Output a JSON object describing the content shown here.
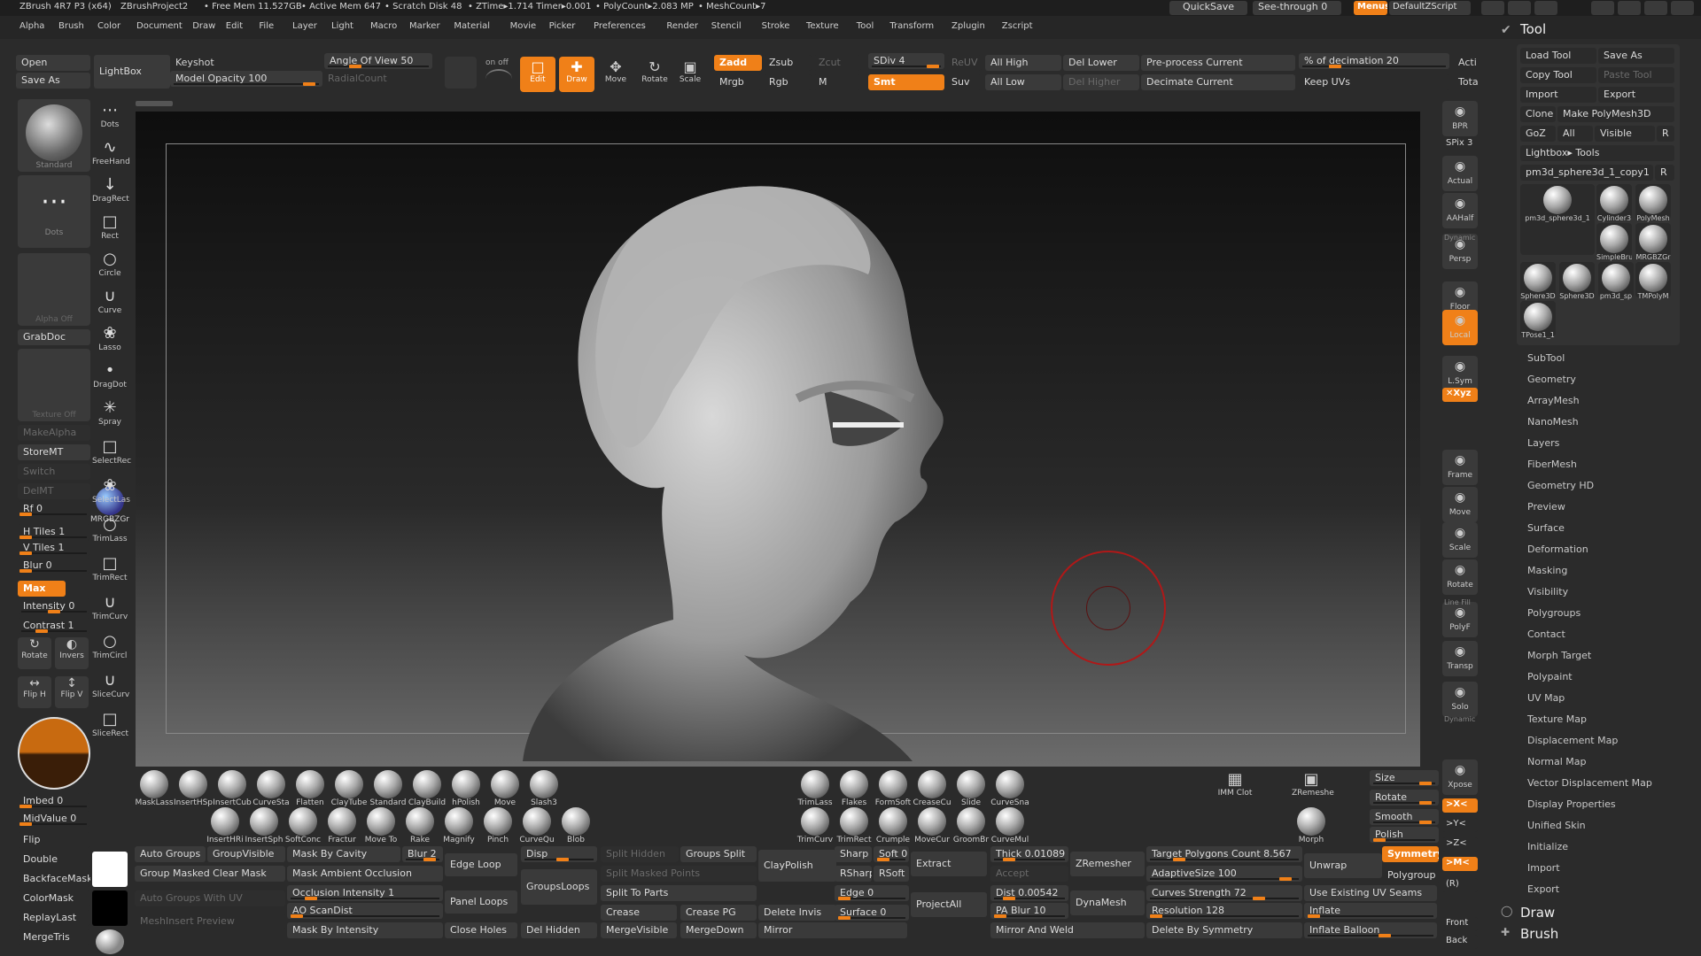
{
  "titlebar": {
    "app": "ZBrush 4R7 P3 (x64)",
    "project": "ZBrushProject2",
    "free_mem": "• Free Mem 11.527GB",
    "active_mem": "• Active Mem 647",
    "scratch": "• Scratch Disk 48",
    "ztime": "• ZTime▸1.714 Timer▸0.001",
    "polycount": "• PolyCount▸2.083 MP",
    "meshcount": "• MeshCount▸7",
    "quicksave": "QuickSave",
    "seethrough": "See-through  0",
    "menus": "Menus",
    "defaultzscript": "DefaultZScript"
  },
  "menu": [
    "Alpha",
    "Brush",
    "Color",
    "Document",
    "Draw",
    "Edit",
    "File",
    "Layer",
    "Light",
    "Macro",
    "Marker",
    "Material",
    "Movie",
    "Picker",
    "Preferences",
    "Render",
    "Stencil",
    "Stroke",
    "Texture",
    "Tool",
    "Transform",
    "Zplugin",
    "Zscript"
  ],
  "toolbar": {
    "open": "Open",
    "save_as": "Save As",
    "lightbox": "LightBox",
    "keyshot": "Keyshot",
    "model_opacity": "Model Opacity 100",
    "angle_of_view": "Angle Of View 50",
    "radialcount": "RadialCount",
    "edit": "Edit",
    "draw": "Draw",
    "move": "Move",
    "rotate": "Rotate",
    "scale": "Scale",
    "zadd": "Zadd",
    "zsub": "Zsub",
    "zcut": "Zcut",
    "mrgb": "Mrgb",
    "rgb": "Rgb",
    "m": "M",
    "sdiv": "SDiv 4",
    "reuv": "ReUV",
    "smt": "Smt",
    "suv": "Suv",
    "all_high": "All High",
    "all_low": "All Low",
    "del_lower": "Del Lower",
    "del_higher": "Del Higher",
    "preprocess": "Pre-process Current",
    "decimate": "Decimate Current",
    "decimation": "% of decimation 20",
    "keep_uvs": "Keep UVs",
    "acti": "Acti",
    "tota": "Tota",
    "on_off": "on  off"
  },
  "left_tray": {
    "standard": "Standard",
    "dots": "Dots",
    "alpha_off": "Alpha Off",
    "grabdoc": "GrabDoc",
    "texture_off": "Texture Off",
    "makealpha": "MakeAlpha",
    "storemt": "StoreMT",
    "switch": "Switch",
    "delmt": "DelMT",
    "rf": "Rf 0",
    "mrgbzgr": "MRGBZGr",
    "h_tiles": "H Tiles 1",
    "v_tiles": "V Tiles 1",
    "blur": "Blur 0",
    "max": "Max",
    "intensity": "Intensity 0",
    "contrast": "Contrast 1",
    "rotate": "Rotate",
    "invers": "Invers",
    "flip_h": "Flip H",
    "flip_v": "Flip V",
    "imbed": "Imbed 0",
    "midvalue": "MidValue 0",
    "flip": "Flip",
    "double": "Double",
    "backfacemask": "BackfaceMask",
    "colormask": "ColorMask",
    "replaylast": "ReplayLast",
    "mergetris": "MergeTris"
  },
  "stroke_icons": [
    "Dots",
    "FreeHand",
    "DragRect",
    "Rect",
    "Circle",
    "Curve",
    "Lasso",
    "DragDot",
    "Spray",
    "SelectRec",
    "SelectLas",
    "TrimLass",
    "TrimRect",
    "TrimCurv",
    "TrimCircl",
    "SliceCurv",
    "SliceRect"
  ],
  "right_shelf": {
    "bpr": "BPR",
    "spix": "SPix 3",
    "actual": "Actual",
    "aahalf": "AAHalf",
    "dynamic": "Dynamic",
    "persp": "Persp",
    "floor": "Floor",
    "local": "Local",
    "lsym": "L.Sym",
    "xyz": "✕Xyz",
    "frame": "Frame",
    "move": "Move",
    "scale": "Scale",
    "rotate": "Rotate",
    "linefill": "Line Fill",
    "polyf": "PolyF",
    "transp": "Transp",
    "dynamic2": "Dynamic",
    "solo": "Solo",
    "xpose": "Xpose",
    "front": "Front",
    "back": "Back",
    "xgt": ">X<",
    "ygt": ">Y<",
    "zgt": ">Z<",
    "mgt": ">M<",
    "r": "(R)"
  },
  "tool_panel": {
    "title": "Tool",
    "load_tool": "Load Tool",
    "save_as": "Save As",
    "copy_tool": "Copy Tool",
    "paste_tool": "Paste Tool",
    "import": "Import",
    "export": "Export",
    "clone": "Clone",
    "make_polymesh": "Make PolyMesh3D",
    "goz": "GoZ",
    "all": "All",
    "visible": "Visible",
    "r": "R",
    "lightbox_tools": "Lightbox▸ Tools",
    "current_tool": "pm3d_sphere3d_1_copy1",
    "r2": "R",
    "thumb_labels": [
      "pm3d_sphere3d_1",
      "Cylinder3",
      "PolyMesh",
      "SimpleBru",
      "MRGBZGr",
      "Sphere3D",
      "Sphere3D",
      "pm3d_sp",
      "TMPolyM",
      "TPose1_1"
    ],
    "subpalettes": [
      "SubTool",
      "Geometry",
      "ArrayMesh",
      "NanoMesh",
      "Layers",
      "FiberMesh",
      "Geometry HD",
      "Preview",
      "Surface",
      "Deformation",
      "Masking",
      "Visibility",
      "Polygroups",
      "Contact",
      "Morph Target",
      "Polypaint",
      "UV Map",
      "Texture Map",
      "Displacement Map",
      "Normal Map",
      "Vector Displacement Map",
      "Display Properties",
      "Unified Skin",
      "Initialize",
      "Import",
      "Export"
    ],
    "draw": "Draw",
    "brush": "Brush"
  },
  "brushes_top": [
    "MaskLass",
    "InsertHSp",
    "InsertCub",
    "CurveSta",
    "Flatten",
    "ClayTube",
    "Standard",
    "ClayBuild",
    "hPolish",
    "Move",
    "Slash3"
  ],
  "brushes_bottom": [
    "InsertHRi",
    "InsertSph",
    "SoftConc",
    "Fractur",
    "Move To",
    "Rake",
    "Magnify",
    "Pinch",
    "CurveQu",
    "Blob"
  ],
  "brushes_right_top": [
    "TrimLass",
    "Flakes",
    "FormSoft",
    "CreaseCu",
    "Slide",
    "CurveSna"
  ],
  "brushes_right_bottom": [
    "TrimCurv",
    "TrimRect",
    "Crumple",
    "MoveCur",
    "GroomBr",
    "CurveMul"
  ],
  "bottom": {
    "imm_clot": "IMM Clot",
    "zremesher_icon": "ZRemeshe",
    "morph": "Morph",
    "size": "Size",
    "rotate": "Rotate",
    "smooth": "Smooth",
    "polish": "Polish",
    "auto_groups": "Auto Groups",
    "groupvisible": "GroupVisible",
    "group_masked_clear_mask": "Group Masked Clear Mask",
    "auto_groups_uv": "Auto Groups With UV",
    "meshinsert_preview": "MeshInsert Preview",
    "mask_by_cavity": "Mask By Cavity",
    "blur2": "Blur 2",
    "mask_ambient_occlusion": "Mask Ambient Occlusion",
    "occlusion_intensity": "Occlusion Intensity 1",
    "ao_scandist": "AO ScanDist",
    "mask_by_intensity": "Mask By Intensity",
    "edge_loop": "Edge Loop",
    "disp": "Disp",
    "panel_loops": "Panel Loops",
    "grouploops": "GroupsLoops",
    "close_holes": "Close Holes",
    "del_hidden": "Del Hidden",
    "split_hidden": "Split Hidden",
    "groups_split": "Groups Split",
    "split_masked_points": "Split Masked Points",
    "split_to_parts": "Split To Parts",
    "crease": "Crease",
    "crease_pg": "Crease PG",
    "mergevisible": "MergeVisible",
    "mergedown": "MergeDown",
    "claypolish": "ClayPolish",
    "delete_invis": "Delete Invis",
    "mirror": "Mirror",
    "sharp": "Sharp",
    "soft": "Soft 0",
    "rsharp": "RSharp",
    "rsoft": "RSoft",
    "edge": "Edge 0",
    "surface": "Surface 0",
    "extract": "Extract",
    "projectall": "ProjectAll",
    "thick": "Thick 0.01089",
    "accept": "Accept",
    "dist": "Dist 0.00542",
    "pa_blur": "PA Blur 10",
    "mirror_and_weld": "Mirror And Weld",
    "zremesher": "ZRemesher",
    "dynamesh": "DynaMesh",
    "target_polygons": "Target Polygons Count 8.567",
    "adaptivesize": "AdaptiveSize 100",
    "curves_strength": "Curves Strength 72",
    "resolution": "Resolution 128",
    "delete_by_symmetry": "Delete By Symmetry",
    "unwrap": "Unwrap",
    "use_existing_uv": "Use Existing UV Seams",
    "inflate": "Inflate",
    "inflate_balloon": "Inflate Balloon",
    "symmetry": "Symmetry",
    "polygroup": "Polygroup"
  },
  "colors": {
    "accent": "#f08018",
    "panel": "#3a3a3a",
    "bg": "#2b2b2b"
  }
}
